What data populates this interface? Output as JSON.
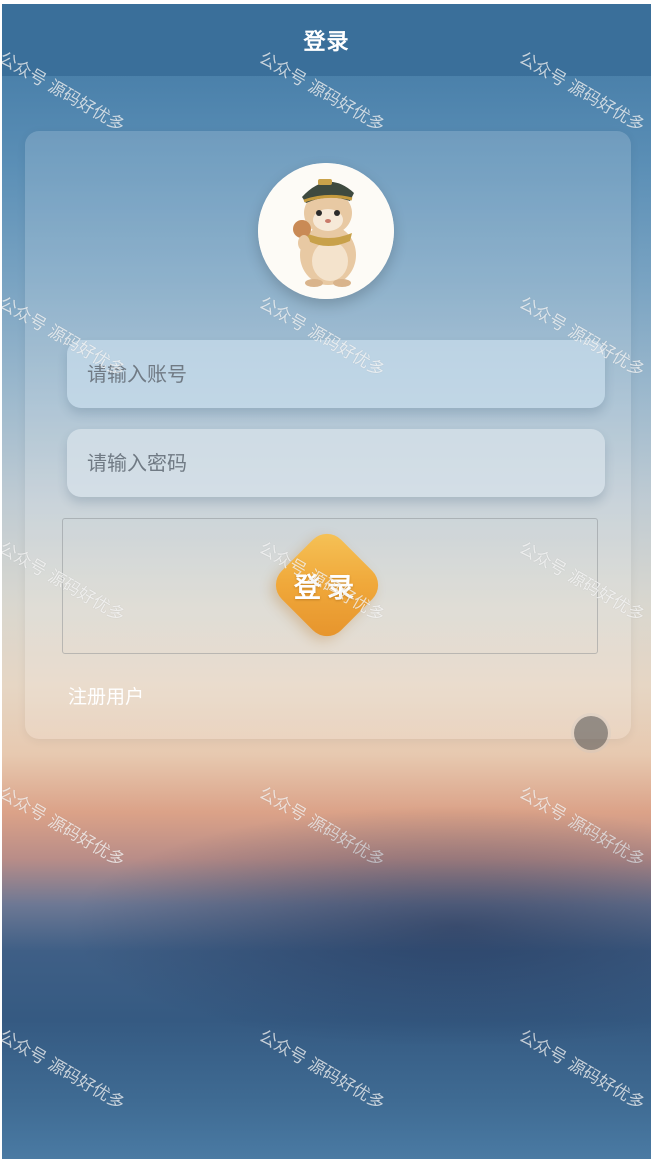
{
  "header": {
    "title": "登录"
  },
  "form": {
    "account_placeholder": "请输入账号",
    "password_placeholder": "请输入密码",
    "login_label": "登录",
    "register_label": "注册用户"
  },
  "watermark": {
    "text": "公众号 源码好优多"
  },
  "colors": {
    "header_bg": "#3a6f9a",
    "button_orange": "#f0a83a",
    "text_white": "#ffffff"
  },
  "icons": {
    "avatar": "hamster-avatar-icon",
    "float": "float-ball-icon"
  }
}
